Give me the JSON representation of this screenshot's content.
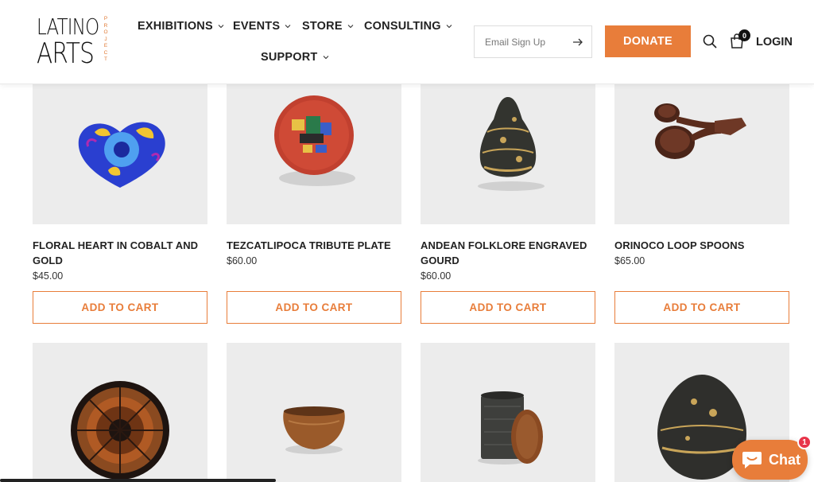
{
  "logo": {
    "line1": "LATINO",
    "line2": "ARTS",
    "vertical": "PROJECT"
  },
  "nav": [
    {
      "label": "EXHIBITIONS"
    },
    {
      "label": "EVENTS"
    },
    {
      "label": "STORE"
    },
    {
      "label": "CONSULTING"
    },
    {
      "label": "SUPPORT"
    }
  ],
  "email": {
    "placeholder": "Email Sign Up"
  },
  "donate_label": "DONATE",
  "cart_count": "0",
  "login_label": "LOGIN",
  "products": [
    {
      "title": "FLORAL HEART IN COBALT AND GOLD",
      "price": "$45.00",
      "button": "ADD TO CART"
    },
    {
      "title": "TEZCATLIPOCA TRIBUTE PLATE",
      "price": "$60.00",
      "button": "ADD TO CART"
    },
    {
      "title": "ANDEAN FOLKLORE ENGRAVED GOURD",
      "price": "$60.00",
      "button": "ADD TO CART"
    },
    {
      "title": "ORINOCO LOOP SPOONS",
      "price": "$65.00",
      "button": "ADD TO CART"
    }
  ],
  "chat": {
    "label": "Chat",
    "badge": "1"
  },
  "colors": {
    "accent": "#e87d3a",
    "badge": "#e8344a"
  }
}
